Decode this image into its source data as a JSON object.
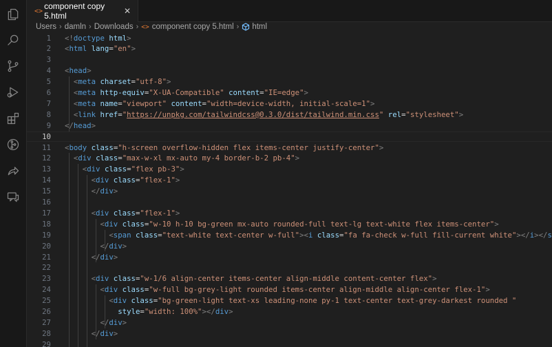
{
  "tab": {
    "icon": "<>",
    "filename": "component copy 5.html",
    "close": "✕"
  },
  "breadcrumb": {
    "items": [
      "Users",
      "damln",
      "Downloads"
    ],
    "file_icon": "<>",
    "file": "component copy 5.html",
    "symbol": "html"
  },
  "activity_icons": [
    "explorer-icon",
    "search-icon",
    "source-control-icon",
    "run-debug-icon",
    "extensions-icon",
    "git-lens-icon",
    "remote-share-icon",
    "comments-icon"
  ],
  "active_line": 10,
  "lines": [
    {
      "n": "1",
      "tokens": [
        [
          "tg",
          "<!"
        ],
        [
          "tn",
          "doctype"
        ],
        [
          "pl",
          " "
        ],
        [
          "at",
          "html"
        ],
        [
          "tg",
          ">"
        ]
      ]
    },
    {
      "n": "2",
      "tokens": [
        [
          "tg",
          "<"
        ],
        [
          "tn",
          "html"
        ],
        [
          "pl",
          " "
        ],
        [
          "at",
          "lang"
        ],
        [
          "pl",
          "="
        ],
        [
          "av",
          "\"en\""
        ],
        [
          "tg",
          ">"
        ]
      ]
    },
    {
      "n": "3",
      "tokens": []
    },
    {
      "n": "4",
      "tokens": [
        [
          "tg",
          "<"
        ],
        [
          "tn",
          "head"
        ],
        [
          "tg",
          ">"
        ]
      ]
    },
    {
      "n": "5",
      "tokens": [
        [
          "pl",
          "  "
        ],
        [
          "tg",
          "<"
        ],
        [
          "tn",
          "meta"
        ],
        [
          "pl",
          " "
        ],
        [
          "at",
          "charset"
        ],
        [
          "pl",
          "="
        ],
        [
          "av",
          "\"utf-8\""
        ],
        [
          "tg",
          ">"
        ]
      ]
    },
    {
      "n": "6",
      "tokens": [
        [
          "pl",
          "  "
        ],
        [
          "tg",
          "<"
        ],
        [
          "tn",
          "meta"
        ],
        [
          "pl",
          " "
        ],
        [
          "at",
          "http-equiv"
        ],
        [
          "pl",
          "="
        ],
        [
          "av",
          "\"X-UA-Compatible\""
        ],
        [
          "pl",
          " "
        ],
        [
          "at",
          "content"
        ],
        [
          "pl",
          "="
        ],
        [
          "av",
          "\"IE=edge\""
        ],
        [
          "tg",
          ">"
        ]
      ]
    },
    {
      "n": "7",
      "tokens": [
        [
          "pl",
          "  "
        ],
        [
          "tg",
          "<"
        ],
        [
          "tn",
          "meta"
        ],
        [
          "pl",
          " "
        ],
        [
          "at",
          "name"
        ],
        [
          "pl",
          "="
        ],
        [
          "av",
          "\"viewport\""
        ],
        [
          "pl",
          " "
        ],
        [
          "at",
          "content"
        ],
        [
          "pl",
          "="
        ],
        [
          "av",
          "\"width=device-width, initial-scale=1\""
        ],
        [
          "tg",
          ">"
        ]
      ]
    },
    {
      "n": "8",
      "tokens": [
        [
          "pl",
          "  "
        ],
        [
          "tg",
          "<"
        ],
        [
          "tn",
          "link"
        ],
        [
          "pl",
          " "
        ],
        [
          "at",
          "href"
        ],
        [
          "pl",
          "="
        ],
        [
          "av",
          "\""
        ],
        [
          "av link",
          "https://unpkg.com/tailwindcss@0.3.0/dist/tailwind.min.css"
        ],
        [
          "av",
          "\""
        ],
        [
          "pl",
          " "
        ],
        [
          "at",
          "rel"
        ],
        [
          "pl",
          "="
        ],
        [
          "av",
          "\"stylesheet\""
        ],
        [
          "tg",
          ">"
        ]
      ]
    },
    {
      "n": "9",
      "tokens": [
        [
          "tg",
          "</"
        ],
        [
          "tn",
          "head"
        ],
        [
          "tg",
          ">"
        ]
      ]
    },
    {
      "n": "10",
      "tokens": []
    },
    {
      "n": "11",
      "tokens": [
        [
          "tg",
          "<"
        ],
        [
          "tn",
          "body"
        ],
        [
          "pl",
          " "
        ],
        [
          "at",
          "class"
        ],
        [
          "pl",
          "="
        ],
        [
          "av",
          "\"h-screen overflow-hidden flex items-center justify-center\""
        ],
        [
          "tg",
          ">"
        ]
      ]
    },
    {
      "n": "12",
      "tokens": [
        [
          "pl",
          "  "
        ],
        [
          "tg",
          "<"
        ],
        [
          "tn",
          "div"
        ],
        [
          "pl",
          " "
        ],
        [
          "at",
          "class"
        ],
        [
          "pl",
          "="
        ],
        [
          "av",
          "\"max-w-xl mx-auto my-4 border-b-2 pb-4\""
        ],
        [
          "tg",
          ">"
        ]
      ]
    },
    {
      "n": "13",
      "tokens": [
        [
          "pl",
          "    "
        ],
        [
          "tg",
          "<"
        ],
        [
          "tn",
          "div"
        ],
        [
          "pl",
          " "
        ],
        [
          "at",
          "class"
        ],
        [
          "pl",
          "="
        ],
        [
          "av",
          "\"flex pb-3\""
        ],
        [
          "tg",
          ">"
        ]
      ]
    },
    {
      "n": "14",
      "tokens": [
        [
          "pl",
          "      "
        ],
        [
          "tg",
          "<"
        ],
        [
          "tn",
          "div"
        ],
        [
          "pl",
          " "
        ],
        [
          "at",
          "class"
        ],
        [
          "pl",
          "="
        ],
        [
          "av",
          "\"flex-1\""
        ],
        [
          "tg",
          ">"
        ]
      ]
    },
    {
      "n": "15",
      "tokens": [
        [
          "pl",
          "      "
        ],
        [
          "tg",
          "</"
        ],
        [
          "tn",
          "div"
        ],
        [
          "tg",
          ">"
        ]
      ]
    },
    {
      "n": "16",
      "tokens": []
    },
    {
      "n": "17",
      "tokens": [
        [
          "pl",
          "      "
        ],
        [
          "tg",
          "<"
        ],
        [
          "tn",
          "div"
        ],
        [
          "pl",
          " "
        ],
        [
          "at",
          "class"
        ],
        [
          "pl",
          "="
        ],
        [
          "av",
          "\"flex-1\""
        ],
        [
          "tg",
          ">"
        ]
      ]
    },
    {
      "n": "18",
      "tokens": [
        [
          "pl",
          "        "
        ],
        [
          "tg",
          "<"
        ],
        [
          "tn",
          "div"
        ],
        [
          "pl",
          " "
        ],
        [
          "at",
          "class"
        ],
        [
          "pl",
          "="
        ],
        [
          "av",
          "\"w-10 h-10 bg-green mx-auto rounded-full text-lg text-white flex items-center\""
        ],
        [
          "tg",
          ">"
        ]
      ]
    },
    {
      "n": "19",
      "tokens": [
        [
          "pl",
          "          "
        ],
        [
          "tg",
          "<"
        ],
        [
          "tn",
          "span"
        ],
        [
          "pl",
          " "
        ],
        [
          "at",
          "class"
        ],
        [
          "pl",
          "="
        ],
        [
          "av",
          "\"text-white text-center w-full\""
        ],
        [
          "tg",
          "><"
        ],
        [
          "tn",
          "i"
        ],
        [
          "pl",
          " "
        ],
        [
          "at",
          "class"
        ],
        [
          "pl",
          "="
        ],
        [
          "av",
          "\"fa fa-check w-full fill-current white\""
        ],
        [
          "tg",
          "></"
        ],
        [
          "tn",
          "i"
        ],
        [
          "tg",
          "></"
        ],
        [
          "tn",
          "span"
        ],
        [
          "tg",
          ">"
        ]
      ]
    },
    {
      "n": "20",
      "tokens": [
        [
          "pl",
          "        "
        ],
        [
          "tg",
          "</"
        ],
        [
          "tn",
          "div"
        ],
        [
          "tg",
          ">"
        ]
      ]
    },
    {
      "n": "21",
      "tokens": [
        [
          "pl",
          "      "
        ],
        [
          "tg",
          "</"
        ],
        [
          "tn",
          "div"
        ],
        [
          "tg",
          ">"
        ]
      ]
    },
    {
      "n": "22",
      "tokens": []
    },
    {
      "n": "23",
      "tokens": [
        [
          "pl",
          "      "
        ],
        [
          "tg",
          "<"
        ],
        [
          "tn",
          "div"
        ],
        [
          "pl",
          " "
        ],
        [
          "at",
          "class"
        ],
        [
          "pl",
          "="
        ],
        [
          "av",
          "\"w-1/6 align-center items-center align-middle content-center flex\""
        ],
        [
          "tg",
          ">"
        ]
      ]
    },
    {
      "n": "24",
      "tokens": [
        [
          "pl",
          "        "
        ],
        [
          "tg",
          "<"
        ],
        [
          "tn",
          "div"
        ],
        [
          "pl",
          " "
        ],
        [
          "at",
          "class"
        ],
        [
          "pl",
          "="
        ],
        [
          "av",
          "\"w-full bg-grey-light rounded items-center align-middle align-center flex-1\""
        ],
        [
          "tg",
          ">"
        ]
      ]
    },
    {
      "n": "25",
      "tokens": [
        [
          "pl",
          "          "
        ],
        [
          "tg",
          "<"
        ],
        [
          "tn",
          "div"
        ],
        [
          "pl",
          " "
        ],
        [
          "at",
          "class"
        ],
        [
          "pl",
          "="
        ],
        [
          "av",
          "\"bg-green-light text-xs leading-none py-1 text-center text-grey-darkest rounded \""
        ]
      ]
    },
    {
      "n": "26",
      "tokens": [
        [
          "pl",
          "            "
        ],
        [
          "at",
          "style"
        ],
        [
          "pl",
          "="
        ],
        [
          "av",
          "\"width: 100%\""
        ],
        [
          "tg",
          "></"
        ],
        [
          "tn",
          "div"
        ],
        [
          "tg",
          ">"
        ]
      ]
    },
    {
      "n": "27",
      "tokens": [
        [
          "pl",
          "        "
        ],
        [
          "tg",
          "</"
        ],
        [
          "tn",
          "div"
        ],
        [
          "tg",
          ">"
        ]
      ]
    },
    {
      "n": "28",
      "tokens": [
        [
          "pl",
          "      "
        ],
        [
          "tg",
          "</"
        ],
        [
          "tn",
          "div"
        ],
        [
          "tg",
          ">"
        ]
      ]
    },
    {
      "n": "29",
      "tokens": []
    }
  ]
}
